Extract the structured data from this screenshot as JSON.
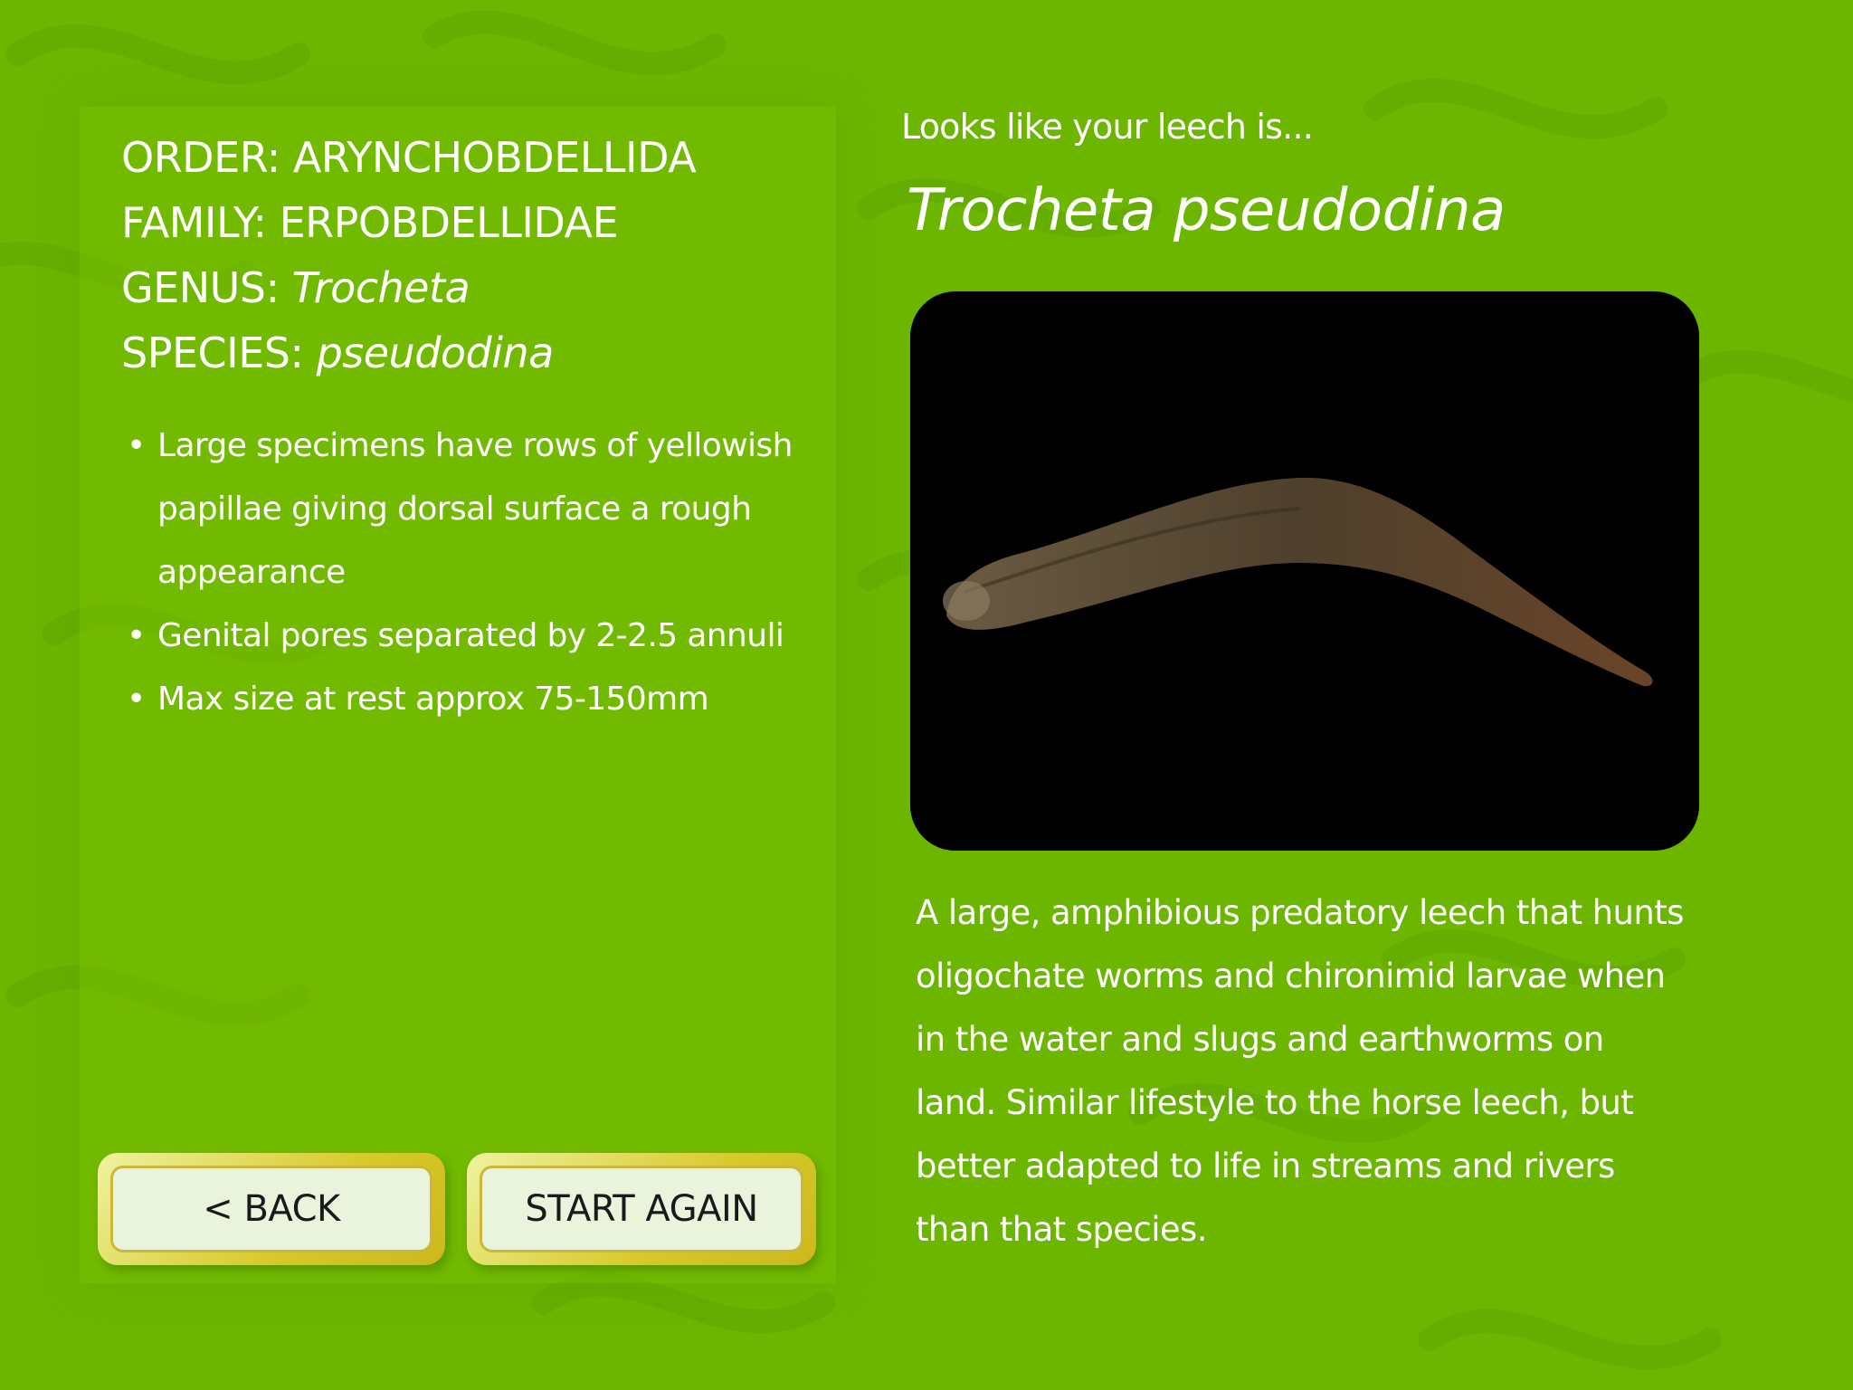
{
  "taxonomy": {
    "order_label": "ORDER:",
    "order_value": "ARYNCHOBDELLIDA",
    "family_label": "FAMILY:",
    "family_value": "ERPOBDELLIDAE",
    "genus_label": "GENUS:",
    "genus_value": "Trocheta",
    "species_label": "SPECIES:",
    "species_value": "pseudodina"
  },
  "features": [
    "Large specimens have rows of yellowish papillae giving dorsal surface a rough appearance",
    "Genital pores separated by 2-2.5 annuli",
    "Max size at rest approx 75-150mm"
  ],
  "buttons": {
    "back": "< BACK",
    "start_again": "START AGAIN"
  },
  "result": {
    "intro": "Looks like your leech is...",
    "species_name": "Trocheta pseudodina"
  },
  "description": "A large, amphibious predatory leech that hunts oligochate worms and chironimid larvae when in the water and slugs and earthworms on land. Similar lifestyle to the horse leech, but better adapted to life in streams and rivers than that species.",
  "colors": {
    "background": "#6cb600",
    "button_frame": "#d8c92a",
    "button_face": "#eaf3dc",
    "text": "#ffffff"
  },
  "icons": {
    "background_pattern": "leech-silhouette-pattern",
    "photo": "leech-specimen-photo"
  }
}
